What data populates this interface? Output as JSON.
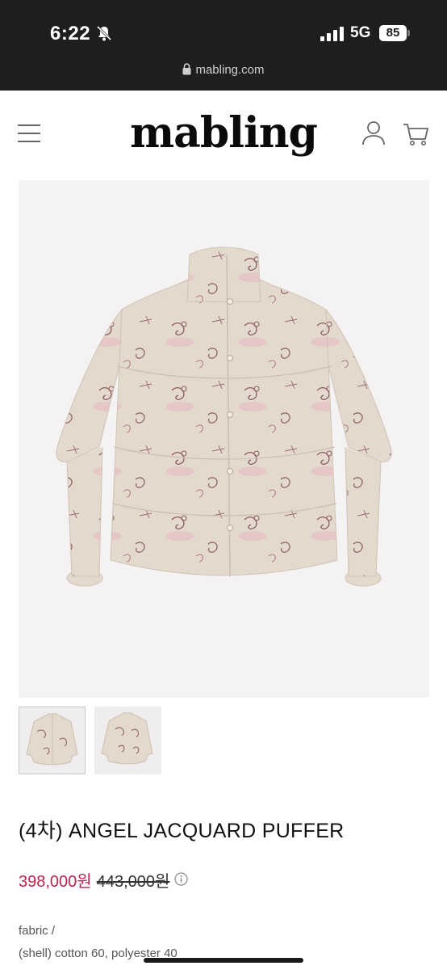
{
  "status_bar": {
    "time": "6:22",
    "network": "5G",
    "battery": "85"
  },
  "browser": {
    "url": "mabling.com"
  },
  "header": {
    "logo": "mabling",
    "icons": [
      "menu-icon",
      "user-icon",
      "cart-icon"
    ]
  },
  "product": {
    "title": "(4차) ANGEL JACQUARD PUFFER",
    "price": "398,000원",
    "original_price": "443,000원",
    "fabric_label": "fabric /",
    "fabric_value": "(shell) cotton 60, polyester 40",
    "thumbnails": [
      "front view",
      "back view"
    ],
    "colors": {
      "sale": "#c2214f",
      "jacket_base": "#e3d9cc",
      "print": "#8a5a62",
      "pink_accent": "#e9b8c4"
    }
  }
}
